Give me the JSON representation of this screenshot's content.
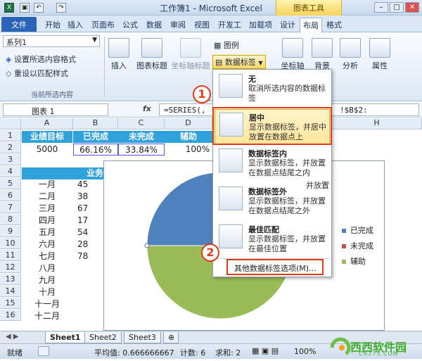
{
  "titlebar": {
    "title": "工作簿1 - Microsoft Excel",
    "context_tools": "图表工具"
  },
  "tabs": [
    "文件",
    "开始",
    "插入",
    "页面布",
    "公式",
    "数据",
    "审阅",
    "视图",
    "开发工",
    "加载项",
    "设计",
    "布局",
    "格式"
  ],
  "ribbon": {
    "series_select": "系列1",
    "format_selection": "设置所选内容格式",
    "reset_style": "重设以匹配样式",
    "current_group": "当前所选内容",
    "insert": "插入",
    "chart_title": "图表标题",
    "axis_title": "坐标轴标题",
    "legend": "图例",
    "data_labels": "数据标签",
    "axes": "坐标轴",
    "background": "背景",
    "analysis": "分析",
    "properties": "属性",
    "partial_label": "标签"
  },
  "formula_bar": {
    "name_box": "图表 1",
    "fx": "fx",
    "formula": "=SERIES(,",
    "formula_tail": "!$B$2:"
  },
  "columns": [
    "A",
    "B",
    "C",
    "D",
    "E",
    "H"
  ],
  "rows": [
    "1",
    "2",
    "3",
    "4",
    "5",
    "6",
    "7",
    "8",
    "9",
    "10",
    "11",
    "12",
    "13",
    "14",
    "15",
    "16"
  ],
  "table": {
    "headers": [
      "业绩目标",
      "已完成",
      "未完成",
      "辅助"
    ],
    "values": [
      "5000",
      "66.16%",
      "33.84%",
      "100%"
    ],
    "section_header": "业务",
    "months": [
      "一月",
      "二月",
      "三月",
      "四月",
      "五月",
      "六月",
      "七月",
      "八月",
      "九月",
      "十月",
      "十一月",
      "十二月"
    ],
    "month_values": [
      "45",
      "38",
      "67",
      "17",
      "54",
      "28",
      "78"
    ]
  },
  "dropdown": {
    "items": [
      {
        "title": "无",
        "desc": "取消所选内容的数据标签"
      },
      {
        "title": "居中",
        "desc": "显示数据标签，并居中放置在数据点上"
      },
      {
        "title": "数据标签内",
        "desc": "显示数据标签，并放置在数据点结尾之内"
      },
      {
        "title": "数据标签外",
        "desc": "显示数据标签，并放置在数据点结尾之外"
      },
      {
        "title": "最佳匹配",
        "desc": "显示数据标签，并放置在最佳位置"
      }
    ],
    "more_options": "其他数据标签选项(M)...",
    "side_tip": "并放置"
  },
  "badges": [
    "1",
    "2"
  ],
  "legend": [
    {
      "label": "已完成",
      "color": "#4f81bd"
    },
    {
      "label": "未完成",
      "color": "#c0504d"
    },
    {
      "label": "辅助",
      "color": "#9bbb59"
    }
  ],
  "sheets": [
    "Sheet1",
    "Sheet2",
    "Sheet3"
  ],
  "status": {
    "ready": "就绪",
    "average": "平均值: 0.666666667",
    "count": "计数: 6",
    "sum": "求和: 2",
    "zoom": "100%"
  },
  "watermark": {
    "text": "西西软件园",
    "sub": "CR173.COM"
  }
}
